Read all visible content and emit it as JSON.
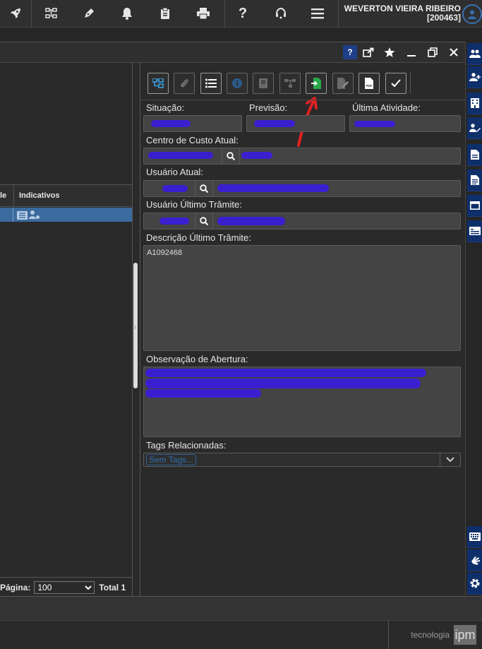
{
  "topbar": {
    "icons": [
      "rocket-icon",
      "org-chart-icon",
      "pen-icon",
      "bell-icon",
      "clipboard-icon",
      "printer-icon",
      "help-icon",
      "headset-icon",
      "menu-icon"
    ],
    "user_name": "WEVERTON VIEIRA RIBEIRO",
    "user_id": "[200463]"
  },
  "window": {
    "help_label": "?",
    "controls": [
      "share-icon",
      "star-icon",
      "minimize-icon",
      "restore-icon",
      "close-icon"
    ]
  },
  "left_panel": {
    "columns": [
      "le",
      "Indicativos"
    ],
    "pager": {
      "page_label": "Página:",
      "page_size": "100",
      "total": "Total 1"
    }
  },
  "right_panel": {
    "toolbar": [
      "sitemap-icon",
      "paperclip-icon",
      "list-icon",
      "info-icon",
      "book-icon",
      "flow-icon",
      "enter-document-icon",
      "edit-document-icon",
      "pdf-icon",
      "check-icon"
    ],
    "fields": {
      "situacao_label": "Situação:",
      "previsao_label": "Previsão:",
      "ultima_atividade_label": "Última Atividade:",
      "centro_custo_label": "Centro de Custo Atual:",
      "usuario_atual_label": "Usuário Atual:",
      "usuario_ultimo_label": "Usuário Último Trâmite:",
      "descricao_label": "Descrição Último Trâmite:",
      "descricao_value": "A1092468",
      "observacao_label": "Observação de Abertura:",
      "tags_label": "Tags Relacionadas:",
      "tags_placeholder": "Sem Tags..."
    }
  },
  "right_sidebar": {
    "icons": [
      "users-icon",
      "user-plus-icon",
      "building-icon",
      "user-edit-icon",
      "document-icon",
      "document-lines-icon",
      "window-icon",
      "id-card-icon"
    ],
    "bottom_icons": [
      "keyboard-icon",
      "sign-language-icon",
      "gear-icon"
    ]
  },
  "footer": {
    "brand_text": "tecnologia",
    "brand_logo": "ipm"
  },
  "colors": {
    "accent": "#3a6fb0",
    "highlight_row": "#3a6a9e",
    "sidebar_button": "#0f2f6a",
    "redaction": "#3a1fd0",
    "annotation_arrow": "#e02020"
  }
}
